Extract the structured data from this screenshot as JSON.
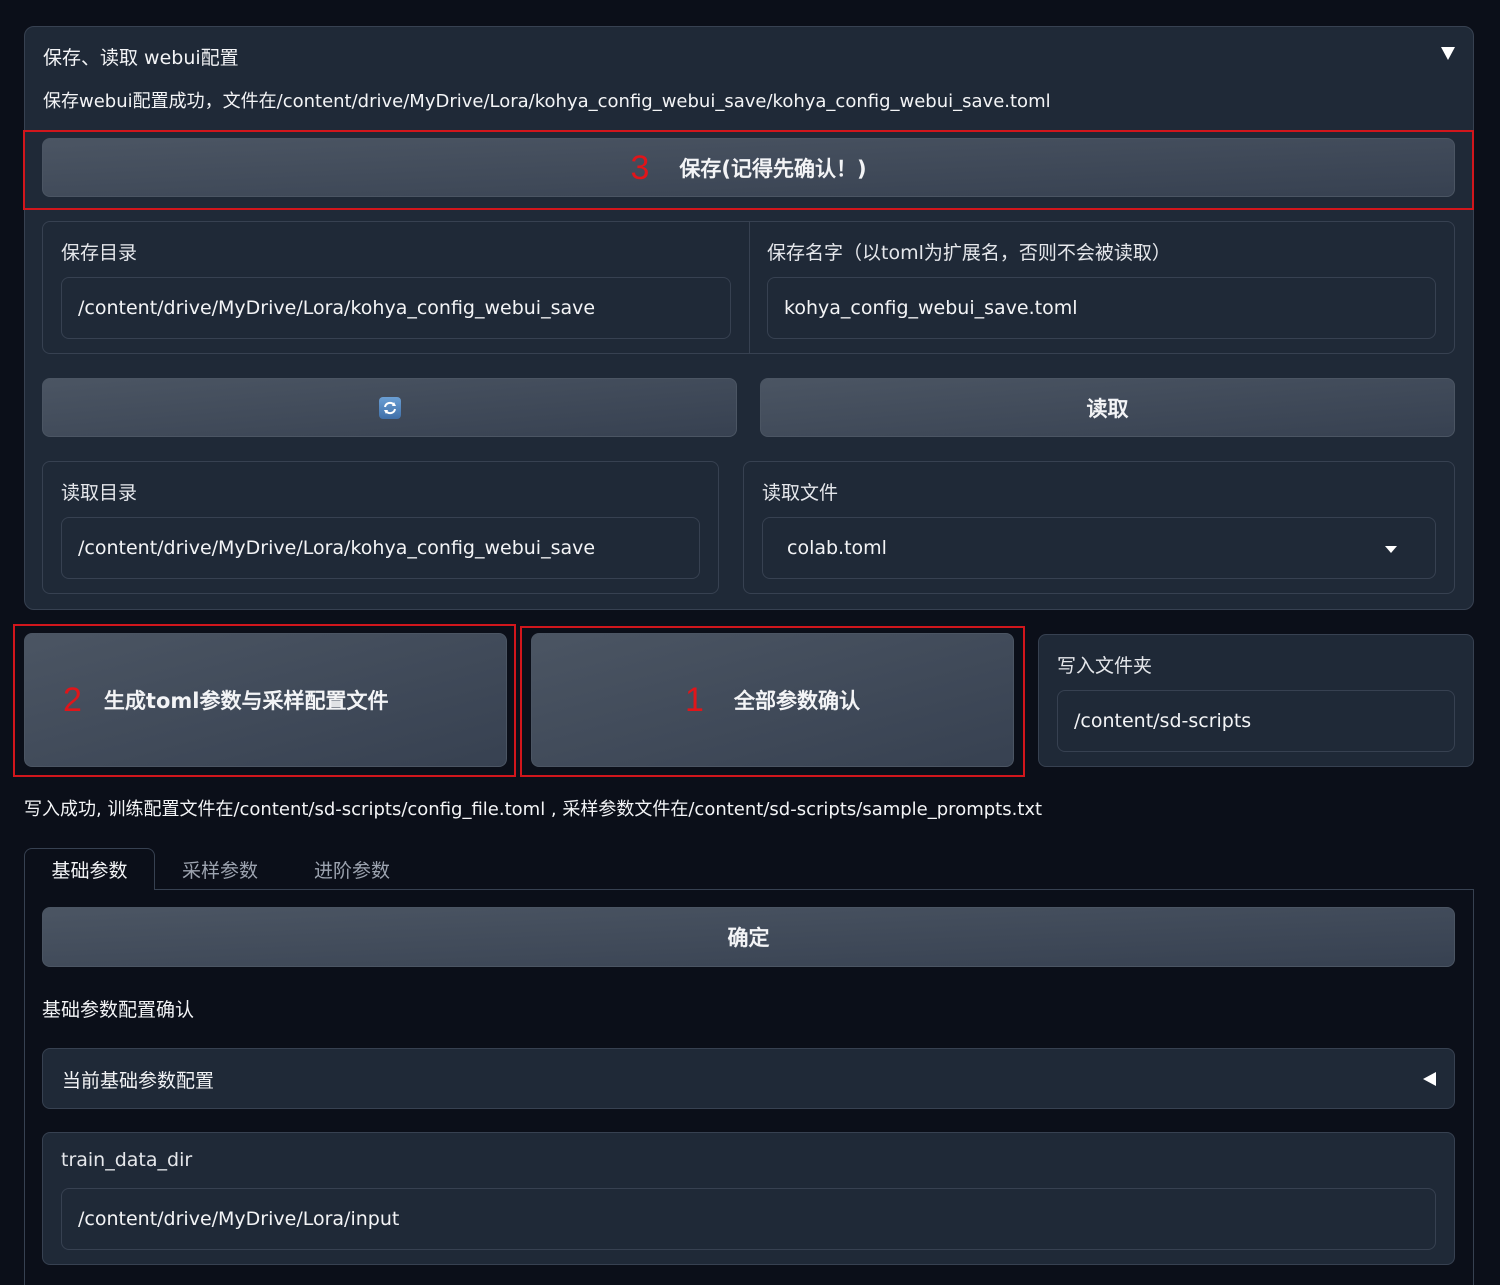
{
  "config_panel": {
    "title": "保存、读取 webui配置",
    "toggle_icon": "triangle-down",
    "save_status": "保存webui配置成功，文件在/content/drive/MyDrive/Lora/kohya_config_webui_save/kohya_config_webui_save.toml",
    "save_button": {
      "marker": "3",
      "label": "保存(记得先确认！)"
    },
    "save_dir": {
      "label": "保存目录",
      "value": "/content/drive/MyDrive/Lora/kohya_config_webui_save"
    },
    "save_name": {
      "label": "保存名字（以toml为扩展名，否则不会被读取）",
      "value": "kohya_config_webui_save.toml"
    },
    "refresh_button": {
      "icon": "refresh-icon"
    },
    "read_button": {
      "label": "读取"
    },
    "read_dir": {
      "label": "读取目录",
      "value": "/content/drive/MyDrive/Lora/kohya_config_webui_save"
    },
    "read_file": {
      "label": "读取文件",
      "selected": "colab.toml"
    }
  },
  "actions": {
    "generate_button": {
      "marker": "2",
      "label": "生成toml参数与采样配置文件"
    },
    "confirm_all_button": {
      "marker": "1",
      "label": "全部参数确认"
    },
    "write_folder": {
      "label": "写入文件夹",
      "value": "/content/sd-scripts"
    }
  },
  "write_status": "写入成功, 训练配置文件在/content/sd-scripts/config_file.toml , 采样参数文件在/content/sd-scripts/sample_prompts.txt",
  "tabs": [
    {
      "label": "基础参数",
      "active": true
    },
    {
      "label": "采样参数",
      "active": false
    },
    {
      "label": "进阶参数",
      "active": false
    }
  ],
  "basic_tab": {
    "confirm_button": "确定",
    "confirm_text": "基础参数配置确认",
    "current_config": {
      "title": "当前基础参数配置",
      "toggle_icon": "triangle-left"
    },
    "train_data_dir": {
      "label": "train_data_dir",
      "value": "/content/drive/MyDrive/Lora/input"
    }
  },
  "colors": {
    "background": "#0b0f19",
    "panel": "#1f2937",
    "border": "#374151",
    "button": "#4b5563",
    "annotation_red": "#d1161c"
  }
}
